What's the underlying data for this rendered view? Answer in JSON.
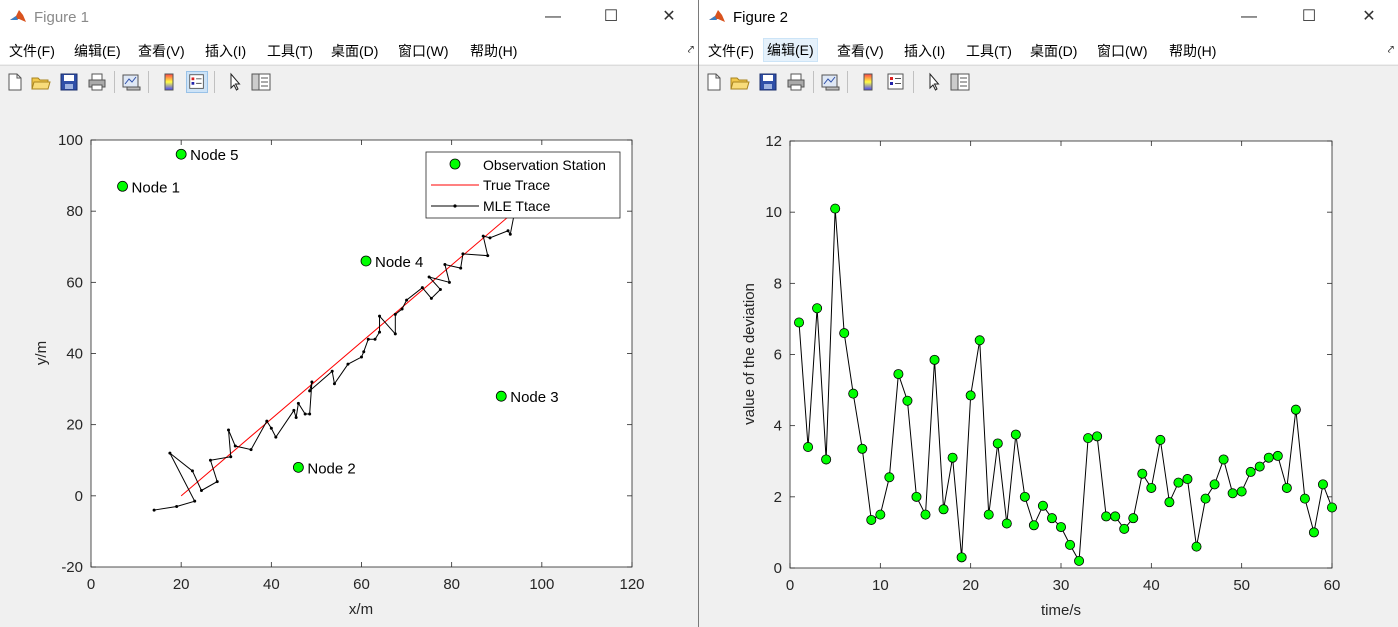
{
  "menus": [
    "文件(F)",
    "编辑(E)",
    "查看(V)",
    "插入(I)",
    "工具(T)",
    "桌面(D)",
    "窗口(W)",
    "帮助(H)"
  ],
  "colors": {
    "station": "#00ff00",
    "true_trace": "#ff0000",
    "mle": "#000000"
  },
  "figure1": {
    "title": "Figure 1",
    "chart_data": {
      "type": "line",
      "xlabel": "x/m",
      "ylabel": "y/m",
      "xlim": [
        0,
        120
      ],
      "ylim": [
        -20,
        100
      ],
      "xticks": [
        "0",
        "20",
        "40",
        "60",
        "80",
        "100",
        "120"
      ],
      "yticks": [
        "-20",
        "0",
        "20",
        "40",
        "60",
        "80",
        "100"
      ],
      "legend": [
        "Observation Station",
        "True Trace",
        "MLE Ttace"
      ],
      "stations": [
        {
          "name": "Node 1",
          "x": 7,
          "y": 87
        },
        {
          "name": "Node 2",
          "x": 46,
          "y": 8
        },
        {
          "name": "Node 3",
          "x": 91,
          "y": 28
        },
        {
          "name": "Node 4",
          "x": 61,
          "y": 66
        },
        {
          "name": "Node 5",
          "x": 20,
          "y": 96
        }
      ],
      "true_trace": [
        [
          20,
          0
        ],
        [
          94,
          80
        ]
      ],
      "mle_trace": [
        [
          14,
          -4
        ],
        [
          19,
          -3
        ],
        [
          23,
          -1.5
        ],
        [
          17.5,
          12
        ],
        [
          22.5,
          7
        ],
        [
          24.5,
          1.5
        ],
        [
          28,
          4
        ],
        [
          26.5,
          10
        ],
        [
          31,
          11
        ],
        [
          30.5,
          18.5
        ],
        [
          32,
          14
        ],
        [
          35.5,
          13
        ],
        [
          39,
          21
        ],
        [
          40,
          19
        ],
        [
          41,
          16.5
        ],
        [
          45,
          24
        ],
        [
          45.5,
          22
        ],
        [
          46,
          26
        ],
        [
          47.5,
          23
        ],
        [
          48.5,
          23
        ],
        [
          49,
          32
        ],
        [
          48.5,
          29.5
        ],
        [
          53.5,
          35
        ],
        [
          54,
          31.5
        ],
        [
          57,
          37
        ],
        [
          60,
          39
        ],
        [
          60.5,
          40.5
        ],
        [
          61.5,
          44
        ],
        [
          63,
          44
        ],
        [
          64,
          46
        ],
        [
          64,
          50.5
        ],
        [
          67.5,
          45.5
        ],
        [
          67.5,
          51
        ],
        [
          69,
          52.5
        ],
        [
          70,
          55
        ],
        [
          73.5,
          58.5
        ],
        [
          75.5,
          55.5
        ],
        [
          77.5,
          58
        ],
        [
          75,
          61.5
        ],
        [
          79.5,
          60
        ],
        [
          78.5,
          65
        ],
        [
          82,
          64
        ],
        [
          82.5,
          68
        ],
        [
          88,
          67.5
        ],
        [
          87,
          73
        ],
        [
          88.5,
          72.5
        ],
        [
          92.5,
          74.5
        ],
        [
          93,
          73.5
        ],
        [
          94,
          80
        ]
      ]
    }
  },
  "figure2": {
    "title": "Figure 2",
    "chart_data": {
      "type": "line",
      "xlabel": "time/s",
      "ylabel": "value of the deviation",
      "xlim": [
        0,
        60
      ],
      "ylim": [
        0,
        12
      ],
      "xticks": [
        "0",
        "10",
        "20",
        "30",
        "40",
        "50",
        "60"
      ],
      "yticks": [
        "0",
        "2",
        "4",
        "6",
        "8",
        "10",
        "12"
      ],
      "x": [
        1,
        2,
        3,
        4,
        5,
        6,
        7,
        8,
        9,
        10,
        11,
        12,
        13,
        14,
        15,
        16,
        17,
        18,
        19,
        20,
        21,
        22,
        23,
        24,
        25,
        26,
        27,
        28,
        29,
        30,
        31,
        32,
        33,
        34,
        35,
        36,
        37,
        38,
        39,
        40,
        41,
        42,
        43,
        44,
        45,
        46,
        47,
        48,
        49,
        50,
        51,
        52,
        53,
        54,
        55,
        56,
        57,
        58,
        59,
        60
      ],
      "values": [
        6.9,
        3.4,
        7.3,
        3.05,
        10.1,
        6.6,
        4.9,
        3.35,
        1.35,
        1.5,
        2.55,
        5.45,
        4.7,
        2.0,
        1.5,
        5.85,
        1.65,
        3.1,
        0.3,
        4.85,
        6.4,
        1.5,
        3.5,
        1.25,
        3.75,
        2.0,
        1.2,
        1.75,
        1.4,
        1.15,
        0.65,
        0.2,
        3.65,
        3.7,
        1.45,
        1.45,
        1.1,
        1.4,
        2.65,
        2.25,
        3.6,
        1.85,
        2.4,
        2.5,
        0.6,
        1.95,
        2.35,
        3.05,
        2.1,
        2.15,
        2.7,
        2.85,
        3.1,
        3.15,
        2.25,
        4.45,
        1.95,
        1.0,
        2.35,
        1.7
      ]
    }
  }
}
